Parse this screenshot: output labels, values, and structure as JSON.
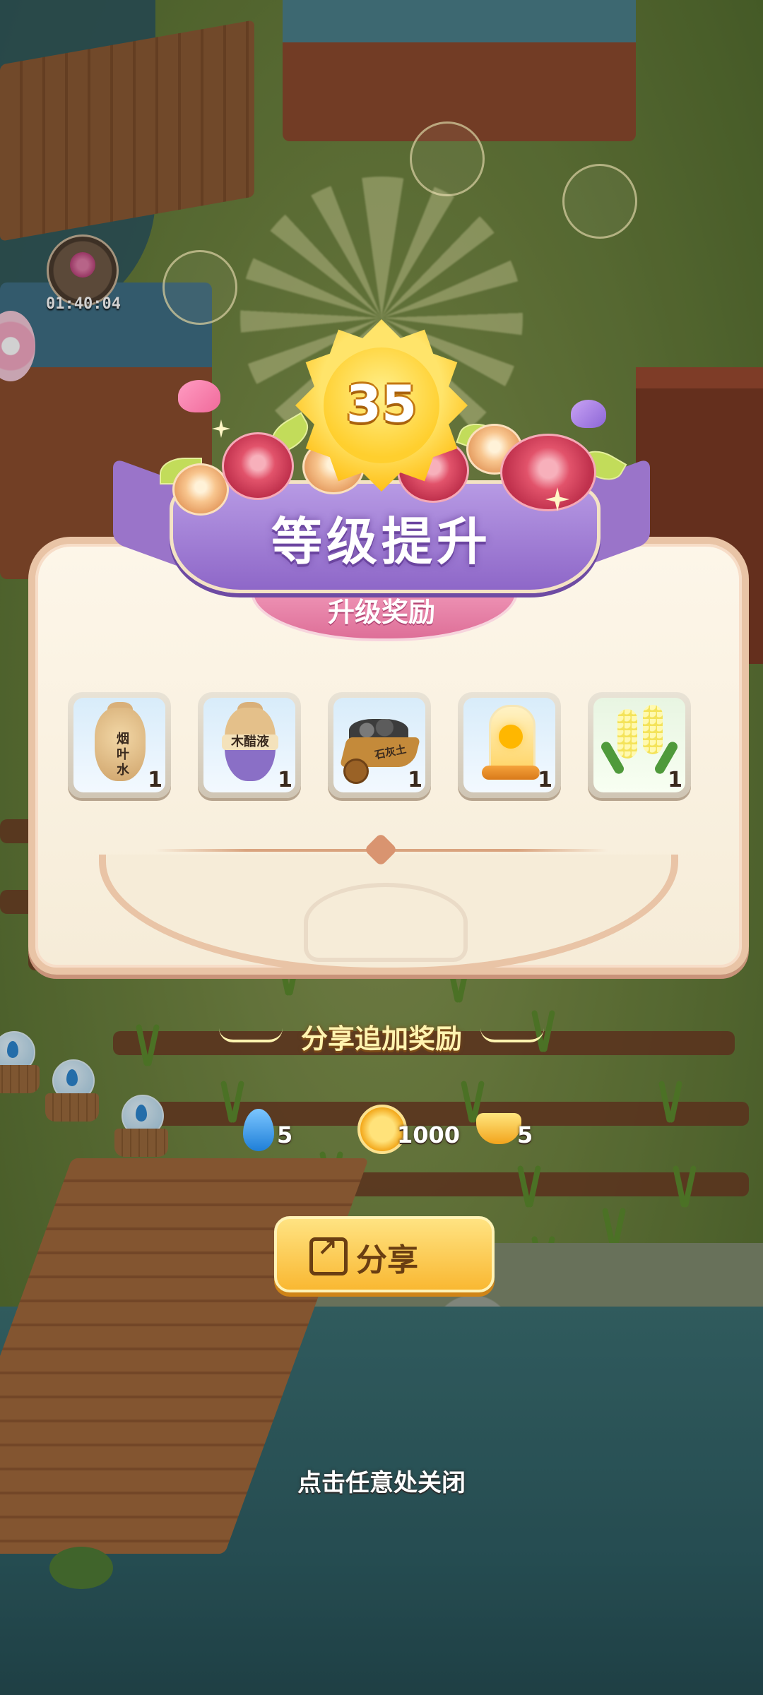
{
  "game": {
    "background_timer": "01:40:04"
  },
  "level_up": {
    "level": "35",
    "title": "等级提升",
    "subtitle": "升级奖励"
  },
  "rewards": [
    {
      "name": "烟叶水",
      "count": "1",
      "icon": "tobacco-water-sack-icon"
    },
    {
      "name": "木醋液",
      "count": "1",
      "icon": "wood-vinegar-sack-icon"
    },
    {
      "name": "石灰土",
      "count": "1",
      "icon": "lime-soil-cart-icon"
    },
    {
      "name": "",
      "count": "1",
      "icon": "sun-dome-icon"
    },
    {
      "name": "",
      "count": "1",
      "icon": "hyacinth-flower-icon"
    }
  ],
  "share": {
    "title": "分享追加奖励",
    "bonuses": [
      {
        "icon": "water-drop-icon",
        "count": "5"
      },
      {
        "icon": "coin-icon",
        "count": "1000"
      },
      {
        "icon": "gold-ingot-icon",
        "count": "5"
      }
    ],
    "button_label": "分享"
  },
  "close_hint": "点击任意处关闭",
  "colors": {
    "banner": "#9a74c9",
    "subbanner": "#de6f98",
    "panel": "#f6ecd8",
    "button": "#f9b832",
    "level_sun": "#ffc21a"
  }
}
